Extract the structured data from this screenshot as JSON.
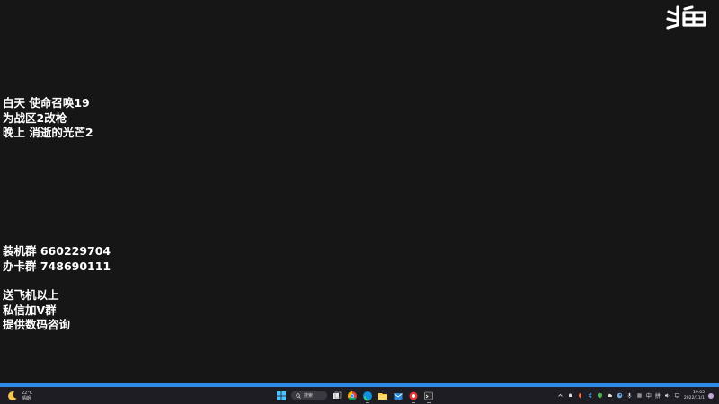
{
  "watermark": {
    "logo_text": "斗鱼"
  },
  "overlay": {
    "schedule": [
      "白天 使命召唤19",
      "为战区2改枪",
      "晚上 消逝的光芒2"
    ],
    "groups": [
      "装机群 660229704",
      "办卡群 748690111"
    ],
    "promo": [
      "送飞机以上",
      "私信加V群",
      "提供数码咨询"
    ]
  },
  "taskbar": {
    "weather": {
      "temp": "22°C",
      "condition": "晴朗",
      "icon": "moon-icon"
    },
    "search_label": "搜索",
    "pinned_apps": [
      "start-icon",
      "search-box",
      "task-view-icon",
      "chrome-icon",
      "edge-icon",
      "file-explorer-icon",
      "mail-icon",
      "app-icon",
      "terminal-icon"
    ],
    "tray": {
      "ime_lang": "中",
      "ime_mode": "拼"
    },
    "clock": {
      "time": "19:05",
      "date": "2022/11/1"
    }
  },
  "colors": {
    "background": "#161616",
    "taskbar": "#1f1d24",
    "accent": "#2f8bea"
  }
}
